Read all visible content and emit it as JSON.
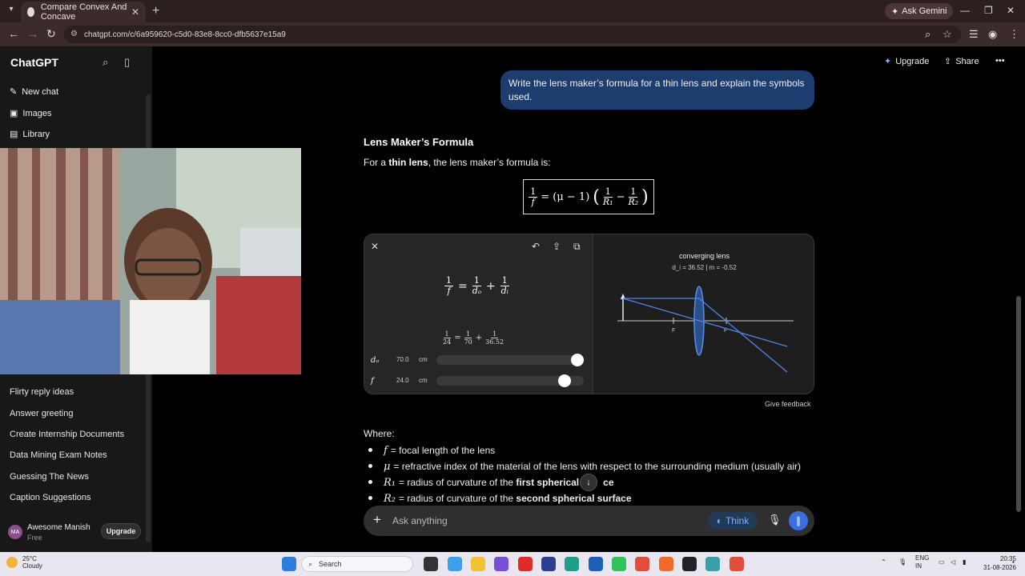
{
  "browser": {
    "tab_title": "Compare Convex And Concave",
    "url": "chatgpt.com/c/6a959620-c5d0-83e8-8cc0-dfb5637e15a9",
    "ask_gemini": "Ask Gemini"
  },
  "sidebar": {
    "brand": "ChatGPT",
    "nav": [
      {
        "label": "New chat",
        "icon": "edit-icon"
      },
      {
        "label": "Images",
        "icon": "images-icon"
      },
      {
        "label": "Library",
        "icon": "library-icon"
      }
    ],
    "chats": [
      "Flirty reply ideas",
      "Answer greeting",
      "Create Internship Documents",
      "Data Mining Exam Notes",
      "Guessing The News",
      "Caption Suggestions"
    ],
    "account": {
      "initials": "MA",
      "name": "Awesome Manish",
      "plan": "Free",
      "upgrade": "Upgrade"
    }
  },
  "header": {
    "upgrade": "Upgrade",
    "share": "Share"
  },
  "conversation": {
    "user_message": "Write the lens maker’s formula for a thin lens and explain the symbols used.",
    "heading": "Lens Maker’s Formula",
    "intro_prefix": "For a ",
    "intro_bold": "thin lens",
    "intro_suffix": ", the lens maker’s formula is:",
    "formula": {
      "lhs_num": "1",
      "lhs_den": "f",
      "eq": "= (μ − 1)",
      "r1_num": "1",
      "r1_den": "R₁",
      "minus": "−",
      "r2_num": "1",
      "r2_den": "R₂"
    },
    "widget": {
      "formula": {
        "lhs_num": "1",
        "lhs_den": "f",
        "do_num": "1",
        "do_den": "dₒ",
        "di_num": "1",
        "di_den": "dᵢ"
      },
      "substituted": {
        "f": "24",
        "do": "70",
        "di": "36.52"
      },
      "sliders": [
        {
          "var": "dₒ",
          "value": "70.0",
          "unit": "cm",
          "fraction": 1.0
        },
        {
          "var": "f",
          "value": "24.0",
          "unit": "cm",
          "fraction": 0.87
        }
      ],
      "diagram_title": "converging lens",
      "diagram_subtitle": "d_i = 36.52 | m = -0.52",
      "focal_labels": [
        "F",
        "F"
      ]
    },
    "feedback": "Give feedback",
    "where": "Where:",
    "symbols": [
      {
        "sym": "f",
        "text": "= focal length of the lens"
      },
      {
        "sym": "μ",
        "text": "= refractive index of the material of the lens with respect to the surrounding medium (usually air)"
      },
      {
        "sym": "R₁",
        "text_prefix": "= radius of curvature of the ",
        "text_bold": "first spherical s",
        "text_tail": "ce"
      },
      {
        "sym": "R₂",
        "text_prefix": "= radius of curvature of the ",
        "text_bold": "second spherical surface"
      }
    ]
  },
  "composer": {
    "placeholder": "Ask anything",
    "think": "Think"
  },
  "taskbar": {
    "temperature": "25°C",
    "weather": "Cloudy",
    "search": "Search",
    "lang1": "ENG",
    "lang2": "IN",
    "time": "20:35",
    "date": "31-08-2026"
  }
}
